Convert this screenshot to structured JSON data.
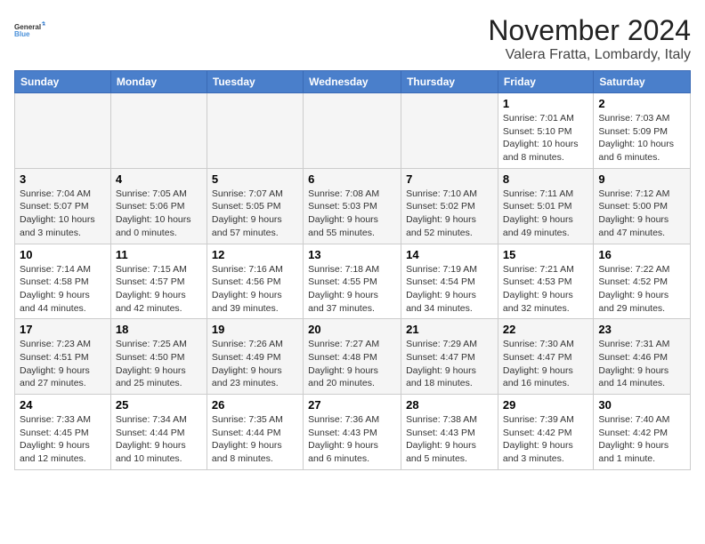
{
  "logo": {
    "line1": "General",
    "line2": "Blue"
  },
  "title": "November 2024",
  "subtitle": "Valera Fratta, Lombardy, Italy",
  "weekdays": [
    "Sunday",
    "Monday",
    "Tuesday",
    "Wednesday",
    "Thursday",
    "Friday",
    "Saturday"
  ],
  "weeks": [
    [
      {
        "day": "",
        "info": ""
      },
      {
        "day": "",
        "info": ""
      },
      {
        "day": "",
        "info": ""
      },
      {
        "day": "",
        "info": ""
      },
      {
        "day": "",
        "info": ""
      },
      {
        "day": "1",
        "info": "Sunrise: 7:01 AM\nSunset: 5:10 PM\nDaylight: 10 hours and 8 minutes."
      },
      {
        "day": "2",
        "info": "Sunrise: 7:03 AM\nSunset: 5:09 PM\nDaylight: 10 hours and 6 minutes."
      }
    ],
    [
      {
        "day": "3",
        "info": "Sunrise: 7:04 AM\nSunset: 5:07 PM\nDaylight: 10 hours and 3 minutes."
      },
      {
        "day": "4",
        "info": "Sunrise: 7:05 AM\nSunset: 5:06 PM\nDaylight: 10 hours and 0 minutes."
      },
      {
        "day": "5",
        "info": "Sunrise: 7:07 AM\nSunset: 5:05 PM\nDaylight: 9 hours and 57 minutes."
      },
      {
        "day": "6",
        "info": "Sunrise: 7:08 AM\nSunset: 5:03 PM\nDaylight: 9 hours and 55 minutes."
      },
      {
        "day": "7",
        "info": "Sunrise: 7:10 AM\nSunset: 5:02 PM\nDaylight: 9 hours and 52 minutes."
      },
      {
        "day": "8",
        "info": "Sunrise: 7:11 AM\nSunset: 5:01 PM\nDaylight: 9 hours and 49 minutes."
      },
      {
        "day": "9",
        "info": "Sunrise: 7:12 AM\nSunset: 5:00 PM\nDaylight: 9 hours and 47 minutes."
      }
    ],
    [
      {
        "day": "10",
        "info": "Sunrise: 7:14 AM\nSunset: 4:58 PM\nDaylight: 9 hours and 44 minutes."
      },
      {
        "day": "11",
        "info": "Sunrise: 7:15 AM\nSunset: 4:57 PM\nDaylight: 9 hours and 42 minutes."
      },
      {
        "day": "12",
        "info": "Sunrise: 7:16 AM\nSunset: 4:56 PM\nDaylight: 9 hours and 39 minutes."
      },
      {
        "day": "13",
        "info": "Sunrise: 7:18 AM\nSunset: 4:55 PM\nDaylight: 9 hours and 37 minutes."
      },
      {
        "day": "14",
        "info": "Sunrise: 7:19 AM\nSunset: 4:54 PM\nDaylight: 9 hours and 34 minutes."
      },
      {
        "day": "15",
        "info": "Sunrise: 7:21 AM\nSunset: 4:53 PM\nDaylight: 9 hours and 32 minutes."
      },
      {
        "day": "16",
        "info": "Sunrise: 7:22 AM\nSunset: 4:52 PM\nDaylight: 9 hours and 29 minutes."
      }
    ],
    [
      {
        "day": "17",
        "info": "Sunrise: 7:23 AM\nSunset: 4:51 PM\nDaylight: 9 hours and 27 minutes."
      },
      {
        "day": "18",
        "info": "Sunrise: 7:25 AM\nSunset: 4:50 PM\nDaylight: 9 hours and 25 minutes."
      },
      {
        "day": "19",
        "info": "Sunrise: 7:26 AM\nSunset: 4:49 PM\nDaylight: 9 hours and 23 minutes."
      },
      {
        "day": "20",
        "info": "Sunrise: 7:27 AM\nSunset: 4:48 PM\nDaylight: 9 hours and 20 minutes."
      },
      {
        "day": "21",
        "info": "Sunrise: 7:29 AM\nSunset: 4:47 PM\nDaylight: 9 hours and 18 minutes."
      },
      {
        "day": "22",
        "info": "Sunrise: 7:30 AM\nSunset: 4:47 PM\nDaylight: 9 hours and 16 minutes."
      },
      {
        "day": "23",
        "info": "Sunrise: 7:31 AM\nSunset: 4:46 PM\nDaylight: 9 hours and 14 minutes."
      }
    ],
    [
      {
        "day": "24",
        "info": "Sunrise: 7:33 AM\nSunset: 4:45 PM\nDaylight: 9 hours and 12 minutes."
      },
      {
        "day": "25",
        "info": "Sunrise: 7:34 AM\nSunset: 4:44 PM\nDaylight: 9 hours and 10 minutes."
      },
      {
        "day": "26",
        "info": "Sunrise: 7:35 AM\nSunset: 4:44 PM\nDaylight: 9 hours and 8 minutes."
      },
      {
        "day": "27",
        "info": "Sunrise: 7:36 AM\nSunset: 4:43 PM\nDaylight: 9 hours and 6 minutes."
      },
      {
        "day": "28",
        "info": "Sunrise: 7:38 AM\nSunset: 4:43 PM\nDaylight: 9 hours and 5 minutes."
      },
      {
        "day": "29",
        "info": "Sunrise: 7:39 AM\nSunset: 4:42 PM\nDaylight: 9 hours and 3 minutes."
      },
      {
        "day": "30",
        "info": "Sunrise: 7:40 AM\nSunset: 4:42 PM\nDaylight: 9 hours and 1 minute."
      }
    ]
  ]
}
